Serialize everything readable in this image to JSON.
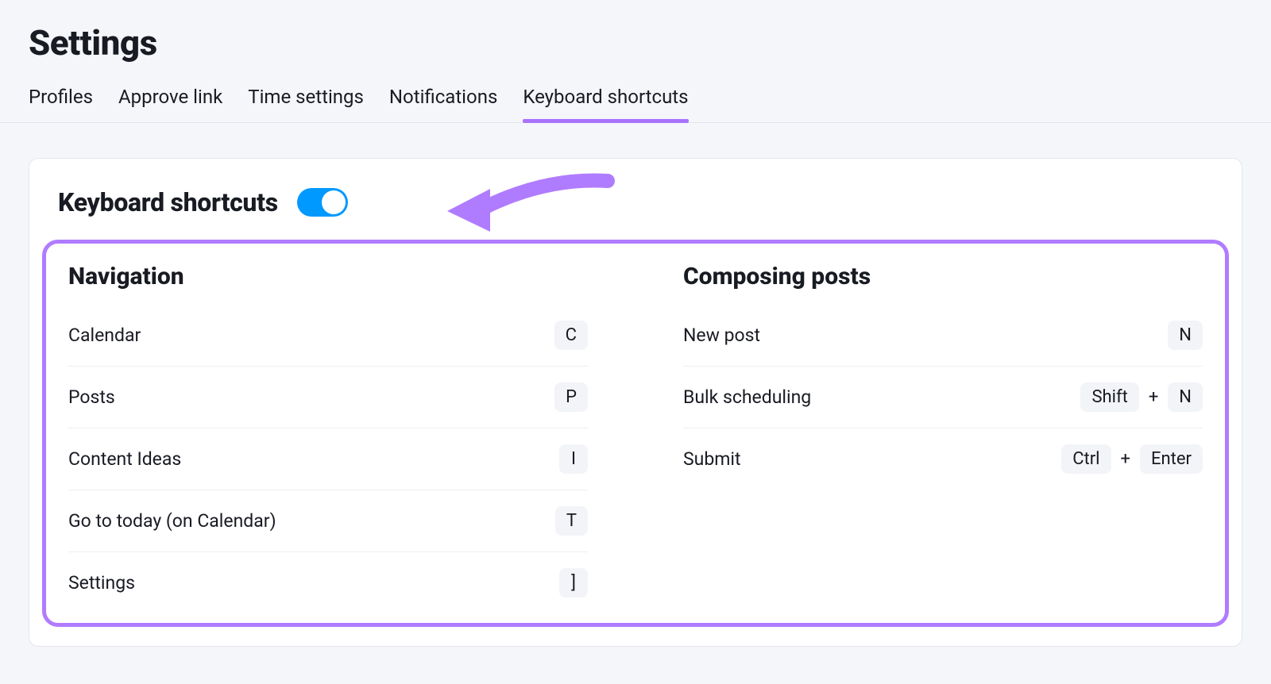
{
  "page_title": "Settings",
  "tabs": [
    {
      "label": "Profiles",
      "active": false
    },
    {
      "label": "Approve link",
      "active": false
    },
    {
      "label": "Time settings",
      "active": false
    },
    {
      "label": "Notifications",
      "active": false
    },
    {
      "label": "Keyboard shortcuts",
      "active": true
    }
  ],
  "card": {
    "title": "Keyboard shortcuts",
    "toggle_on": true
  },
  "sections": {
    "navigation": {
      "title": "Navigation",
      "rows": [
        {
          "label": "Calendar",
          "keys": [
            "C"
          ]
        },
        {
          "label": "Posts",
          "keys": [
            "P"
          ]
        },
        {
          "label": "Content Ideas",
          "keys": [
            "I"
          ]
        },
        {
          "label": "Go to today (on Calendar)",
          "keys": [
            "T"
          ]
        },
        {
          "label": "Settings",
          "keys": [
            "]"
          ]
        }
      ]
    },
    "composing": {
      "title": "Composing posts",
      "rows": [
        {
          "label": "New post",
          "keys": [
            "N"
          ]
        },
        {
          "label": "Bulk scheduling",
          "keys": [
            "Shift",
            "N"
          ]
        },
        {
          "label": "Submit",
          "keys": [
            "Ctrl",
            "Enter"
          ]
        }
      ]
    }
  },
  "plus": "+"
}
